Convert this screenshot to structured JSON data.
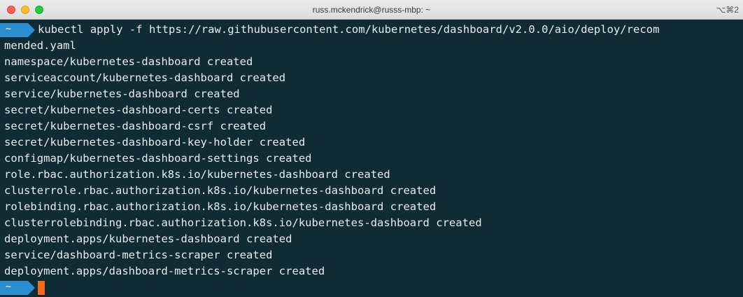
{
  "window": {
    "title": "russ.mckendrick@russs-mbp: ~",
    "shortcut": "⌥⌘2"
  },
  "prompt": {
    "tilde": "~"
  },
  "terminal": {
    "command": "kubectl apply -f https://raw.githubusercontent.com/kubernetes/dashboard/v2.0.0/aio/deploy/recom",
    "command_wrap": "mended.yaml",
    "output": [
      "namespace/kubernetes-dashboard created",
      "serviceaccount/kubernetes-dashboard created",
      "service/kubernetes-dashboard created",
      "secret/kubernetes-dashboard-certs created",
      "secret/kubernetes-dashboard-csrf created",
      "secret/kubernetes-dashboard-key-holder created",
      "configmap/kubernetes-dashboard-settings created",
      "role.rbac.authorization.k8s.io/kubernetes-dashboard created",
      "clusterrole.rbac.authorization.k8s.io/kubernetes-dashboard created",
      "rolebinding.rbac.authorization.k8s.io/kubernetes-dashboard created",
      "clusterrolebinding.rbac.authorization.k8s.io/kubernetes-dashboard created",
      "deployment.apps/kubernetes-dashboard created",
      "service/dashboard-metrics-scraper created",
      "deployment.apps/dashboard-metrics-scraper created"
    ]
  },
  "colors": {
    "background": "#0f2b34",
    "prompt_badge": "#2a8fd0",
    "cursor": "#f26b1d",
    "text": "#e6eef0"
  }
}
